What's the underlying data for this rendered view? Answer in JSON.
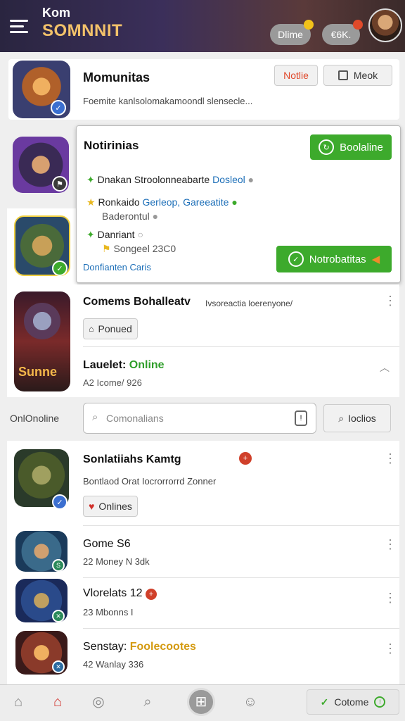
{
  "header": {
    "brand_top": "Kom",
    "brand_main": "SOMNNIT",
    "btn_1": "Dlime",
    "btn_2": "€6K.",
    "dot_1_color": "#f2c21a",
    "dot_2_color": "#e04a2a"
  },
  "card1": {
    "title": "Momunitas",
    "desc": "Foemite kanlsolomakamoondl slensecle...",
    "btn_notlie": "Notlie",
    "btn_meok": "Meok"
  },
  "popup": {
    "title": "Notirinias",
    "top_button": "Boolaline",
    "row1_a": "Dnakan Stroolonneabarte",
    "row1_b": "Dosleol",
    "row2_a": "Ronkaido",
    "row2_b": "Gerleop, Gareeatite",
    "row2_c": "Baderontul",
    "row3_a": "Danriant",
    "row3_b": "Songeel 23C0",
    "bottom_button": "Notrobatitas",
    "link_left": "Donfianten Caris"
  },
  "card3": {
    "title": "Comems Bohalleatv",
    "meta": "Ivsoreactia loerenyone/",
    "chip": "Ponued",
    "status_label": "Lauelet:",
    "status_value": "Online",
    "stats": "A2 Icome/ 926"
  },
  "search": {
    "left_label": "OnlOnoline",
    "placeholder": "Comonalians",
    "right_btn": "Ioclios"
  },
  "list": [
    {
      "title": "Sonlatiiahs Kamtg",
      "desc": "Bontlaod Orat Iocrorrorrd Zonner",
      "chip": "Onlines"
    },
    {
      "title": "Gome S6",
      "desc": "22 Money N 3dk"
    },
    {
      "title": "Vlorelats 12",
      "desc": "23 Mbonns I"
    },
    {
      "title": "Senstay:",
      "title_highlight": "Foolecootes",
      "desc": "42 Wanlay 336"
    }
  ],
  "bottom_nav": {
    "cta": "Cotome"
  }
}
